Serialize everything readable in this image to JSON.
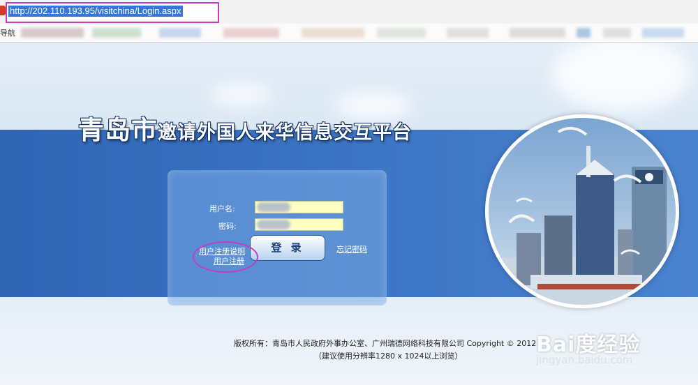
{
  "browser": {
    "url": "http://202.110.193.95/visitchina/Login.aspx",
    "bookmarks_start": "导航"
  },
  "header": {
    "title_city": "青岛市",
    "title_rest": "邀请外国人来华信息交互平台"
  },
  "login": {
    "username_label": "用户名:",
    "password_label": "密码:",
    "login_button": "登 录",
    "forgot_password": "忘记密码",
    "registration_info": "用户注册说明",
    "register": "用户注册"
  },
  "footer": {
    "copyright": "版权所有：青岛市人民政府外事办公室、广州瑞德网络科技有限公司 Copyright © 2012",
    "resolution_note": "（建议使用分辨率1280 x 1024以上浏览）"
  },
  "watermark": {
    "brand": "Bai度经验",
    "url": "jingyan.baidu.com"
  },
  "colors": {
    "annotation": "#c53bc2",
    "band": "#3a73c2",
    "input_bg": "#ffffc0"
  }
}
